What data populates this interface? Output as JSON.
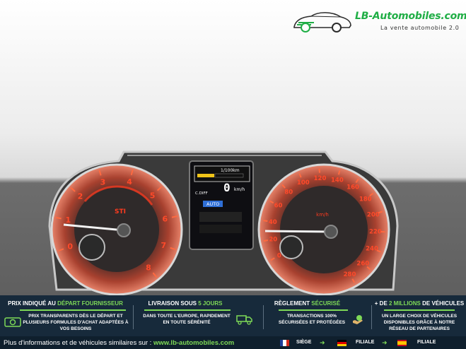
{
  "logo": {
    "name": "LB-Automobiles.com",
    "tagline": "La vente automobile 2.0"
  },
  "photo": {
    "left_gauge": {
      "labels": [
        "0",
        "1",
        "2",
        "3",
        "4",
        "5",
        "6",
        "7",
        "8"
      ],
      "brand_mark": "STI"
    },
    "right_gauge": {
      "labels": [
        "0",
        "20",
        "40",
        "60",
        "80",
        "100",
        "120",
        "140",
        "160",
        "180",
        "200",
        "220",
        "240",
        "260",
        "280"
      ],
      "unit": "km/h"
    },
    "display": {
      "consumption": "1/100km",
      "speed": "0",
      "speed_unit": "km/h",
      "diff_label": "C.DIFF",
      "mode": "AUTO"
    }
  },
  "band": {
    "col1": {
      "title_a": "PRIX INDIQUÉ AU ",
      "title_b": "DÉPART FOURNISSEUR",
      "text": "PRIX TRANSPARENTS DÈS LE DÉPART ET PLUSIEURS FORMULES D'ACHAT ADAPTÉES À VOS BESOINS",
      "icon": "cash-icon"
    },
    "col2": {
      "title_a": "LIVRAISON SOUS ",
      "title_b": "5 JOURS",
      "text": "DANS TOUTE L'EUROPE, RAPIDEMENT EN TOUTE SÉRÉNITÉ",
      "icon": "truck-icon"
    },
    "col3": {
      "title_a": "RÈGLEMENT ",
      "title_b": "SÉCURISÉ",
      "text": "TRANSACTIONS 100% SÉCURISÉES ET PROTÉGÉES",
      "icon": "secure-payment-icon"
    },
    "col4": {
      "title_a": "+ DE ",
      "title_b": "2 MILLIONS",
      "title_c": " DE VÉHICULES",
      "text": "UN LARGE CHOIX DE VÉHICULES DISPONIBLES GRÂCE À NOTRE RÉSEAU DE PARTENAIRES"
    }
  },
  "footer": {
    "text": "Plus d'informations et de véhicules similaires sur : ",
    "link": "www.lb-automobiles.com",
    "siege": "SIÈGE",
    "filiale1": "FILIALE",
    "filiale2": "FILIALE"
  },
  "colors": {
    "accent_green": "#7ed957",
    "band_bg": "#172a3b",
    "gauge_red": "#ff3b1f"
  }
}
